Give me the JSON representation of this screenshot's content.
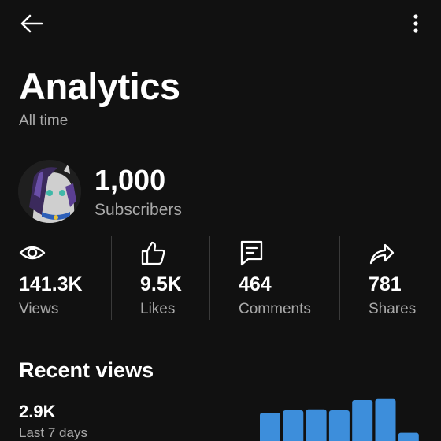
{
  "header": {
    "title": "Analytics",
    "subtitle": "All time"
  },
  "icons": {
    "back": "back-arrow-icon",
    "more": "more-vertical-icon",
    "views": "eye-icon",
    "likes": "thumbs-up-icon",
    "comments": "comment-icon",
    "shares": "share-icon"
  },
  "channel": {
    "subscribers_count": "1,000",
    "subscribers_label": "Subscribers"
  },
  "stats": {
    "views": {
      "value": "141.3K",
      "label": "Views"
    },
    "likes": {
      "value": "9.5K",
      "label": "Likes"
    },
    "comments": {
      "value": "464",
      "label": "Comments"
    },
    "shares": {
      "value": "781",
      "label": "Shares"
    }
  },
  "recent": {
    "title": "Recent views",
    "value": "2.9K",
    "label": "Last 7 days",
    "bar_levels": [
      0.55,
      0.6,
      0.62,
      0.6,
      0.8,
      0.82,
      0.16
    ]
  },
  "colors": {
    "background": "#111111",
    "text_primary": "#ffffff",
    "text_secondary": "#a9a9a9",
    "bar": "#3d8edb"
  }
}
